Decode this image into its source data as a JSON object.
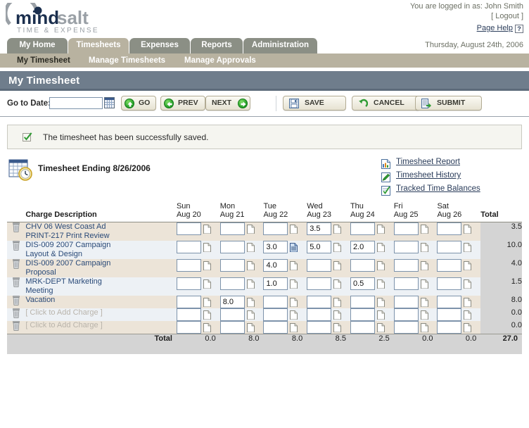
{
  "header": {
    "logo_main": "mindsalt",
    "logo_sub": "TIME & EXPENSE",
    "logged_in_text": "You are logged in as: John Smith",
    "logout_label": "[ Logout ]",
    "page_help_label": "Page Help",
    "help_button_label": "?",
    "date_stamp": "Thursday, August 24th, 2006"
  },
  "tabs": [
    {
      "label": "My Home",
      "active": false
    },
    {
      "label": "Timesheets",
      "active": true
    },
    {
      "label": "Expenses",
      "active": false
    },
    {
      "label": "Reports",
      "active": false
    },
    {
      "label": "Administration",
      "active": false
    }
  ],
  "subnav": [
    {
      "label": "My Timesheet",
      "active": true
    },
    {
      "label": "Manage Timesheets",
      "active": false
    },
    {
      "label": "Manage Approvals",
      "active": false
    }
  ],
  "page_title": "My Timesheet",
  "toolbar": {
    "goto_label": "Go to Date:",
    "date_value": "",
    "date_placeholder": "",
    "calendar_icon": "calendar-icon",
    "go_label": "GO",
    "prev_label": "PREV",
    "next_label": "NEXT",
    "save_label": "SAVE",
    "cancel_label": "CANCEL",
    "submit_label": "SUBMIT"
  },
  "alert": {
    "icon": "checkmark-icon",
    "message": "The timesheet has been successfully saved."
  },
  "sheet": {
    "icon": "calendar-clock-icon",
    "title": "Timesheet Ending 8/26/2006"
  },
  "links": [
    {
      "icon": "report-icon",
      "label": "Timesheet Report"
    },
    {
      "icon": "pencil-icon",
      "label": "Timesheet History"
    },
    {
      "icon": "check-page-icon",
      "label": "Tracked Time Balances"
    }
  ],
  "table": {
    "desc_header": "Charge Description",
    "total_header": "Total",
    "days": [
      {
        "dow": "Sun",
        "date": "Aug 20"
      },
      {
        "dow": "Mon",
        "date": "Aug 21"
      },
      {
        "dow": "Tue",
        "date": "Aug 22"
      },
      {
        "dow": "Wed",
        "date": "Aug 23"
      },
      {
        "dow": "Thu",
        "date": "Aug 24"
      },
      {
        "dow": "Fri",
        "date": "Aug 25"
      },
      {
        "dow": "Sat",
        "date": "Aug 26"
      }
    ],
    "rows": [
      {
        "line1": "CHV 06 West Coast Ad",
        "line2": "PRINT-217 Print Review",
        "placeholder": false,
        "hours": [
          "",
          "",
          "",
          "3.5",
          "",
          "",
          ""
        ],
        "notes": [
          false,
          false,
          false,
          false,
          false,
          false,
          false
        ],
        "total": "3.5"
      },
      {
        "line1": "DIS-009 2007 Campaign",
        "line2": "Layout & Design",
        "placeholder": false,
        "hours": [
          "",
          "",
          "3.0",
          "5.0",
          "2.0",
          "",
          ""
        ],
        "notes": [
          false,
          false,
          true,
          false,
          false,
          false,
          false
        ],
        "total": "10.0"
      },
      {
        "line1": "DIS-009 2007 Campaign",
        "line2": "Proposal",
        "placeholder": false,
        "hours": [
          "",
          "",
          "4.0",
          "",
          "",
          "",
          ""
        ],
        "notes": [
          false,
          false,
          false,
          false,
          false,
          false,
          false
        ],
        "total": "4.0"
      },
      {
        "line1": "MRK-DEPT Marketing",
        "line2": "Meeting",
        "placeholder": false,
        "hours": [
          "",
          "",
          "1.0",
          "",
          "0.5",
          "",
          ""
        ],
        "notes": [
          false,
          false,
          false,
          false,
          false,
          false,
          false
        ],
        "total": "1.5"
      },
      {
        "line1": "Vacation",
        "line2": "",
        "placeholder": false,
        "hours": [
          "",
          "8.0",
          "",
          "",
          "",
          "",
          ""
        ],
        "notes": [
          false,
          false,
          false,
          false,
          false,
          false,
          false
        ],
        "total": "8.0"
      },
      {
        "line1": "[ Click to Add Charge ]",
        "line2": "",
        "placeholder": true,
        "hours": [
          "",
          "",
          "",
          "",
          "",
          "",
          ""
        ],
        "notes": [
          false,
          false,
          false,
          false,
          false,
          false,
          false
        ],
        "total": "0.0"
      },
      {
        "line1": "[ Click to Add Charge ]",
        "line2": "",
        "placeholder": true,
        "hours": [
          "",
          "",
          "",
          "",
          "",
          "",
          ""
        ],
        "notes": [
          false,
          false,
          false,
          false,
          false,
          false,
          false
        ],
        "total": "0.0"
      }
    ],
    "total_row": {
      "label": "Total",
      "values": [
        "0.0",
        "8.0",
        "8.0",
        "8.5",
        "2.5",
        "0.0",
        "0.0"
      ],
      "grand_total": "27.0"
    }
  },
  "colors": {
    "tab_active": "#b8b2a0",
    "tab_inactive": "#8b8f85",
    "title_bar": "#6f7d8c",
    "row_odd": "#ece4d8",
    "row_even": "#edf1f5",
    "total_cell": "#d4d4d4",
    "link": "#2a3c5a",
    "charge_link": "#2a4a78"
  }
}
